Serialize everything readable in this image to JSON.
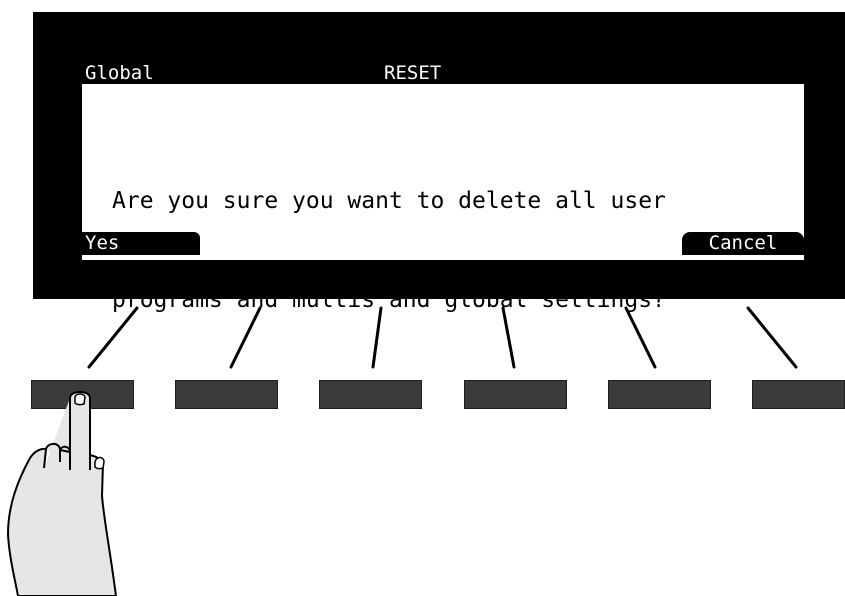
{
  "screen": {
    "header_left": "Global",
    "header_title": "RESET",
    "message_lines": [
      "Are you sure you want to delete all user",
      "programs and multis and global settings?"
    ],
    "softkey_left": "Yes",
    "softkey_right": "Cancel"
  },
  "colors": {
    "bezel": "#000000",
    "lcd_background": "#ffffff",
    "buttons": "#3b3b3b",
    "hand_fill": "#e6e6e6"
  },
  "icons": [
    "pointing-hand-icon"
  ]
}
